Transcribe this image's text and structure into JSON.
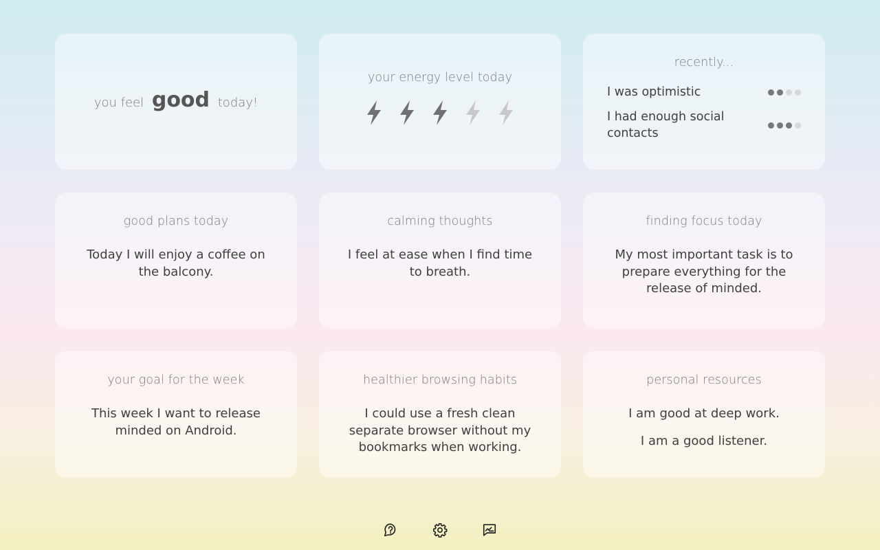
{
  "mood": {
    "prefix": "you feel",
    "value": "good",
    "suffix": "today!"
  },
  "energy": {
    "title": "your energy level today",
    "level": 3,
    "max": 5
  },
  "recently": {
    "title": "recently...",
    "items": [
      {
        "label": "I was optimistic",
        "rating": 2,
        "max": 4
      },
      {
        "label": "I had enough social contacts",
        "rating": 3,
        "max": 4
      }
    ]
  },
  "cards": {
    "plans": {
      "title": "good plans today",
      "text": "Today I will enjoy a coffee on the balcony."
    },
    "calming": {
      "title": "calming thoughts",
      "text": "I feel at ease when I find time to breath."
    },
    "focus": {
      "title": "finding focus today",
      "text": "My most important task is to prepare everything for the release of minded."
    },
    "goal": {
      "title": "your goal for the week",
      "text": "This week I want to release minded on Android."
    },
    "browsing": {
      "title": "healthier browsing habits",
      "text": "I could use a fresh clean separate browser without my bookmarks when working."
    },
    "resources": {
      "title": "personal resources",
      "items": [
        "I am good at deep work.",
        "I am a good listener."
      ]
    }
  },
  "toolbar": {
    "icons": [
      "help-icon",
      "settings-icon",
      "feedback-icon"
    ]
  }
}
